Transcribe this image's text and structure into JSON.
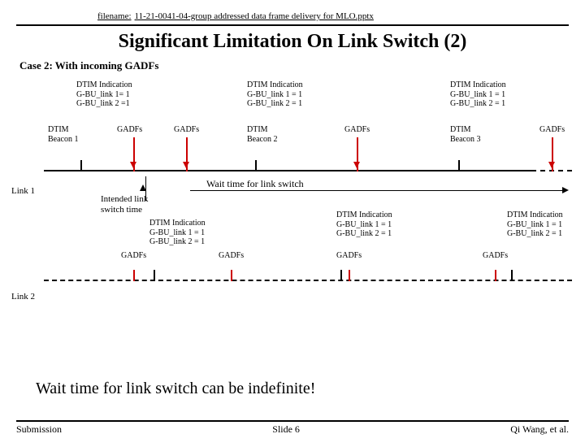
{
  "header": {
    "filename_label": "filename:",
    "filename_value": "11-21-0041-04-group addressed data frame delivery for MLO.pptx"
  },
  "title": "Significant Limitation On Link Switch (2)",
  "case_title": "Case 2: With incoming GADFs",
  "link1_label": "Link 1",
  "link2_label": "Link 2",
  "dtim_indications": {
    "ind1": {
      "l1": "DTIM Indication",
      "l2": "G-BU_link 1= 1",
      "l3": "G-BU_link 2 =1"
    },
    "ind2": {
      "l1": "DTIM Indication",
      "l2": "G-BU_link 1 = 1",
      "l3": "G-BU_link 2 = 1"
    },
    "ind3": {
      "l1": "DTIM Indication",
      "l2": "G-BU_link 1 = 1",
      "l3": "G-BU_link 2 = 1"
    },
    "ind4": {
      "l1": "DTIM Indication",
      "l2": "G-BU_link 1 = 1",
      "l3": "G-BU_link 2 = 1"
    },
    "ind5": {
      "l1": "DTIM Indication",
      "l2": "G-BU_link 1 = 1",
      "l3": "G-BU_link 2 = 1"
    },
    "ind6": {
      "l1": "DTIM Indication",
      "l2": "G-BU_link 1 = 1",
      "l3": "G-BU_link 2 = 1"
    }
  },
  "beacons": {
    "b1": {
      "l1": "DTIM",
      "l2": "Beacon 1"
    },
    "b2": {
      "l1": "DTIM",
      "l2": "Beacon 2"
    },
    "b3": {
      "l1": "DTIM",
      "l2": "Beacon 3"
    }
  },
  "gadfs_label": "GADFs",
  "wait_label": "Wait time for link switch",
  "intended_label_l1": "Intended link",
  "intended_label_l2": "switch time",
  "conclusion": "Wait time for link switch can be indefinite!",
  "footer": {
    "left": "Submission",
    "center": "Slide 6",
    "right": "Qi Wang, et al."
  }
}
